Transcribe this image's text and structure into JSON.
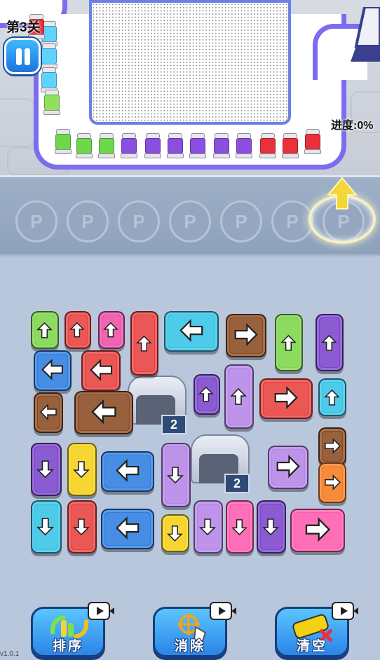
{
  "hud": {
    "level_label": "第3关",
    "progress_label": "进度:0%"
  },
  "tubes": [
    "#5fd3ff",
    "#5fd3ff",
    "#5fd3ff",
    "#8fe05a",
    "#6fd84a",
    "#6fd84a",
    "#6fd84a",
    "#8b4fe0",
    "#8b4fe0",
    "#8b4fe0",
    "#8b4fe0",
    "#8b4fe0",
    "#8b4fe0",
    "#e8313a",
    "#e8313a",
    "#e8313a",
    "#e8313a"
  ],
  "parking": {
    "slot_label": "P",
    "slot_count": 7
  },
  "vehicles": [
    {
      "color": "lime",
      "dir": "up"
    },
    {
      "color": "red",
      "dir": "up"
    },
    {
      "color": "pink",
      "dir": "up"
    },
    {
      "color": "red",
      "dir": "up"
    },
    {
      "color": "cyan",
      "dir": "left"
    },
    {
      "color": "brown",
      "dir": "right"
    },
    {
      "color": "lime",
      "dir": "up"
    },
    {
      "color": "purple",
      "dir": "up"
    },
    {
      "color": "blue",
      "dir": "left"
    },
    {
      "color": "red",
      "dir": "left"
    },
    {
      "color": "purple",
      "dir": "up"
    },
    {
      "color": "lilac",
      "dir": "up"
    },
    {
      "color": "red",
      "dir": "right"
    },
    {
      "color": "cyan",
      "dir": "up"
    },
    {
      "color": "brown",
      "dir": "left"
    },
    {
      "color": "brown",
      "dir": "left"
    },
    {
      "color": "brown",
      "dir": "right"
    },
    {
      "color": "purple",
      "dir": "down"
    },
    {
      "color": "yellow",
      "dir": "down"
    },
    {
      "color": "blue",
      "dir": "left"
    },
    {
      "color": "lilac",
      "dir": "down"
    },
    {
      "color": "lilac",
      "dir": "right"
    },
    {
      "color": "orange",
      "dir": "right"
    },
    {
      "color": "cyan",
      "dir": "down"
    },
    {
      "color": "red",
      "dir": "down"
    },
    {
      "color": "blue",
      "dir": "left"
    },
    {
      "color": "yellow",
      "dir": "down"
    },
    {
      "color": "lilac",
      "dir": "down"
    },
    {
      "color": "hotpink",
      "dir": "down"
    },
    {
      "color": "purple",
      "dir": "down"
    },
    {
      "color": "hotpink",
      "dir": "right"
    }
  ],
  "garages": [
    {
      "count": "2"
    },
    {
      "count": "2"
    }
  ],
  "tools": {
    "sort_label": "排序",
    "eliminate_label": "消除",
    "clear_label": "清空"
  },
  "version": "v1.0.1"
}
